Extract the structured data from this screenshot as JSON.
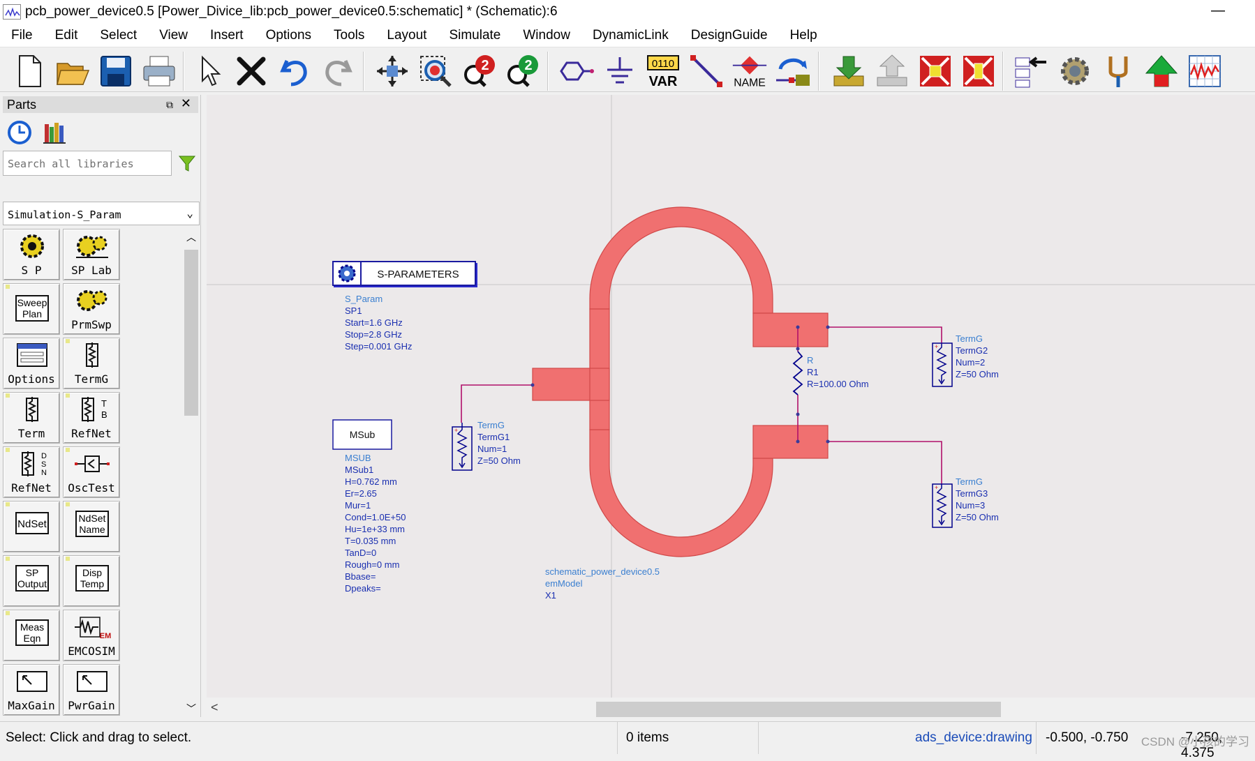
{
  "window": {
    "title": "pcb_power_device0.5 [Power_Divice_lib:pcb_power_device0.5:schematic] * (Schematic):6",
    "minimize": "—"
  },
  "menu": [
    "File",
    "Edit",
    "Select",
    "View",
    "Insert",
    "Options",
    "Tools",
    "Layout",
    "Simulate",
    "Window",
    "DynamicLink",
    "DesignGuide",
    "Help"
  ],
  "toolbar": {
    "var_label": "VAR",
    "var_digits": "0110",
    "name_label": "NAME",
    "zoom_in_num": "2",
    "zoom_out_num": "2"
  },
  "parts": {
    "title": "Parts",
    "search_placeholder": "Search all libraries",
    "library": "Simulation-S_Param",
    "items": [
      "S P",
      "SP Lab",
      "Sweep Plan",
      "PrmSwp",
      "Options",
      "TermG",
      "Term",
      "RefNet",
      "RefNet",
      "OscTest",
      "NdSet",
      "NdSet Name",
      "SP Output",
      "Disp Temp",
      "Meas Eqn",
      "EMCOSIM",
      "MaxGain",
      "PwrGain"
    ],
    "icon_text": {
      "sweep": [
        "Sweep",
        "Plan"
      ],
      "ndset": "NdSet",
      "ndsetname": [
        "NdSet",
        "Name"
      ],
      "spoutput": [
        "SP",
        "Output"
      ],
      "disptemp": [
        "Disp",
        "Temp"
      ],
      "measeqn": [
        "Meas",
        "Eqn"
      ],
      "tb": [
        "T",
        "B"
      ],
      "dsn": [
        "D",
        "S",
        "N"
      ],
      "em": "EM"
    }
  },
  "schematic": {
    "sparam_title": "S-PARAMETERS",
    "sparam_lines": [
      "S_Param",
      "SP1",
      "Start=1.6 GHz",
      "Stop=2.8 GHz",
      "Step=0.001 GHz"
    ],
    "msub_title": "MSub",
    "msub_lines": [
      "MSUB",
      "MSub1",
      "H=0.762 mm",
      "Er=2.65",
      "Mur=1",
      "Cond=1.0E+50",
      "Hu=1e+33 mm",
      "T=0.035 mm",
      "TanD=0",
      "Rough=0 mm",
      "Bbase=",
      "Dpeaks="
    ],
    "termg1_lines": [
      "TermG",
      "TermG1",
      "Num=1",
      "Z=50 Ohm"
    ],
    "termg2_lines": [
      "TermG",
      "TermG2",
      "Num=2",
      "Z=50 Ohm"
    ],
    "termg3_lines": [
      "TermG",
      "TermG3",
      "Num=3",
      "Z=50 Ohm"
    ],
    "r_lines": [
      "R",
      "R1",
      "R=100.00 Ohm"
    ],
    "em_lines": [
      "schematic_power_device0.5",
      "emModel",
      "X1"
    ],
    "colors": {
      "trace": "#f07070",
      "wire": "#b0106a",
      "component": "#00008b",
      "label_type": "#3a7fd0",
      "label_val": "#1a2fb0"
    }
  },
  "status": {
    "hint": "Select: Click and drag to select.",
    "items": "0 items",
    "context": "ads_device:drawing",
    "coords1": "-0.500, -0.750",
    "coords2": "-7.250, 4.375",
    "watermark": "CSDN @小孩的学习"
  }
}
